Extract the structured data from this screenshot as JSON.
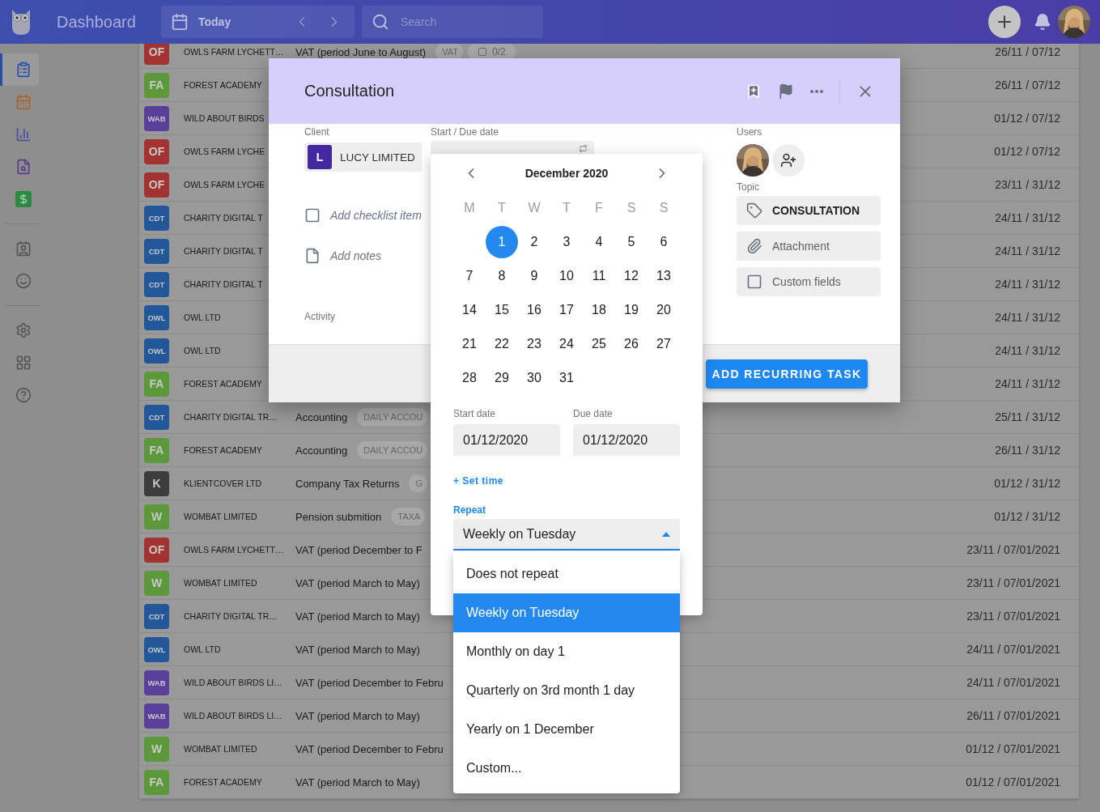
{
  "topbar": {
    "title": "Dashboard",
    "date_label": "Today",
    "search_placeholder": "Search"
  },
  "sidebar": {
    "groups": [
      {
        "items": [
          {
            "selected": true
          },
          {
            "selected": false
          },
          {
            "selected": false
          },
          {
            "selected": false
          },
          {
            "selected": false
          }
        ]
      },
      {
        "items": [
          {
            "selected": false
          },
          {
            "selected": false
          }
        ]
      },
      {
        "items": [
          {
            "selected": false
          },
          {
            "selected": false
          },
          {
            "selected": false
          }
        ]
      }
    ]
  },
  "rows": [
    {
      "initials": "OF",
      "color": "#a33331",
      "client": "OWLS FARM LYCHETT…",
      "task": "VAT (period June to August)",
      "tags": [
        "VAT"
      ],
      "checklist": "0/2",
      "dates": "26/11 / 07/12"
    },
    {
      "initials": "FA",
      "color": "#5b993b",
      "client": "FOREST ACADEMY",
      "dates": "26/11 / 07/12"
    },
    {
      "initials": "WAB",
      "color": "#5a3f9a",
      "client": "WILD ABOUT BIRDS",
      "dates": "01/12 / 07/12"
    },
    {
      "initials": "OF",
      "color": "#a33331",
      "client": "OWLS FARM LYCHE",
      "dates": "01/12 / 07/12"
    },
    {
      "initials": "OF",
      "color": "#a33331",
      "client": "OWLS FARM LYCHE",
      "dates": "23/11 / 31/12"
    },
    {
      "initials": "CDT",
      "color": "#22589a",
      "client": "CHARITY DIGITAL T",
      "dates": "24/11 / 31/12"
    },
    {
      "initials": "CDT",
      "color": "#22589a",
      "client": "CHARITY DIGITAL T",
      "dates": "24/11 / 31/12"
    },
    {
      "initials": "CDT",
      "color": "#22589a",
      "client": "CHARITY DIGITAL T",
      "dates": "24/11 / 31/12"
    },
    {
      "initials": "OWL",
      "color": "#22589a",
      "client": "OWL LTD",
      "dates": "24/11 / 31/12"
    },
    {
      "initials": "OWL",
      "color": "#22589a",
      "client": "OWL LTD",
      "dates": "24/11 / 31/12"
    },
    {
      "initials": "FA",
      "color": "#5b993b",
      "client": "FOREST ACADEMY",
      "dates": "24/11 / 31/12"
    },
    {
      "initials": "CDT",
      "color": "#22589a",
      "client": "CHARITY DIGITAL TR…",
      "task": "Accounting",
      "tags": [
        "DAILY ACCOU"
      ],
      "dates": "25/11 / 31/12"
    },
    {
      "initials": "FA",
      "color": "#5b993b",
      "client": "FOREST ACADEMY",
      "task": "Accounting",
      "tags": [
        "DAILY ACCOU"
      ],
      "dates": "26/11 / 31/12"
    },
    {
      "initials": "K",
      "color": "#3c3c3c",
      "client": "KLIENTCOVER LTD",
      "task": "Company Tax Returns",
      "tags": [
        "G"
      ],
      "dates": "01/12 / 31/12"
    },
    {
      "initials": "W",
      "color": "#5b993b",
      "client": "WOMBAT LIMITED",
      "task": "Pension submition",
      "tags": [
        "TAXA"
      ],
      "dates": "01/12 / 31/12"
    },
    {
      "initials": "OF",
      "color": "#a33331",
      "client": "OWLS FARM LYCHETT…",
      "task": "VAT (period December to F",
      "dates": "23/11 / 07/01/2021"
    },
    {
      "initials": "W",
      "color": "#5b993b",
      "client": "WOMBAT LIMITED",
      "task": "VAT (period March to May)",
      "dates": "23/11 / 07/01/2021"
    },
    {
      "initials": "CDT",
      "color": "#22589a",
      "client": "CHARITY DIGITAL TR…",
      "task": "VAT (period March to May)",
      "dates": "23/11 / 07/01/2021"
    },
    {
      "initials": "OWL",
      "color": "#22589a",
      "client": "OWL LTD",
      "task": "VAT (period March to May)",
      "dates": "24/11 / 07/01/2021"
    },
    {
      "initials": "WAB",
      "color": "#5a3f9a",
      "client": "WILD ABOUT BIRDS LI…",
      "task": "VAT (period December to Febru",
      "dates": "24/11 / 07/01/2021"
    },
    {
      "initials": "WAB",
      "color": "#5a3f9a",
      "client": "WILD ABOUT BIRDS LI…",
      "task": "VAT (period March to May)",
      "dates": "26/11 / 07/01/2021"
    },
    {
      "initials": "W",
      "color": "#5b993b",
      "client": "WOMBAT LIMITED",
      "task": "VAT (period December to Febru",
      "dates": "01/12 / 07/01/2021"
    },
    {
      "initials": "FA",
      "color": "#5b993b",
      "client": "FOREST ACADEMY",
      "task": "VAT (period March to May)",
      "dates": "01/12 / 07/01/2021"
    }
  ],
  "modal": {
    "title": "Consultation",
    "client_label": "Client",
    "client_initial": "L",
    "client_name": "LUCY LIMITED",
    "date_label": "Start / Due date",
    "checklist_placeholder": "Add checklist item",
    "notes_placeholder": "Add notes",
    "activity_label": "Activity",
    "users_label": "Users",
    "topic_label": "Topic",
    "topic": "CONSULTATION",
    "attachment": "Attachment",
    "custom_fields": "Custom fields",
    "submit": "ADD RECURRING TASK"
  },
  "calendar": {
    "month": "December 2020",
    "weekdays": [
      "M",
      "T",
      "W",
      "T",
      "F",
      "S",
      "S"
    ],
    "weeks": [
      [
        {
          "label": "1",
          "selected": true
        },
        {
          "label": "2",
          "selected": false
        },
        {
          "label": "3",
          "selected": false
        },
        {
          "label": "4",
          "selected": false
        },
        {
          "label": "5",
          "selected": false
        },
        {
          "label": "6",
          "selected": false
        }
      ],
      [
        {
          "label": "7",
          "selected": false
        },
        {
          "label": "8",
          "selected": false
        },
        {
          "label": "9",
          "selected": false
        },
        {
          "label": "10",
          "selected": false
        },
        {
          "label": "11",
          "selected": false
        },
        {
          "label": "12",
          "selected": false
        },
        {
          "label": "13",
          "selected": false
        }
      ],
      [
        {
          "label": "14",
          "selected": false
        },
        {
          "label": "15",
          "selected": false
        },
        {
          "label": "16",
          "selected": false
        },
        {
          "label": "17",
          "selected": false
        },
        {
          "label": "18",
          "selected": false
        },
        {
          "label": "19",
          "selected": false
        },
        {
          "label": "20",
          "selected": false
        }
      ],
      [
        {
          "label": "21",
          "selected": false
        },
        {
          "label": "22",
          "selected": false
        },
        {
          "label": "23",
          "selected": false
        },
        {
          "label": "24",
          "selected": false
        },
        {
          "label": "25",
          "selected": false
        },
        {
          "label": "26",
          "selected": false
        },
        {
          "label": "27",
          "selected": false
        }
      ],
      [
        {
          "label": "28",
          "selected": false
        },
        {
          "label": "29",
          "selected": false
        },
        {
          "label": "30",
          "selected": false
        },
        {
          "label": "31",
          "selected": false
        }
      ]
    ],
    "start_label": "Start date",
    "start_value": "01/12/2020",
    "due_label": "Due date",
    "due_value": "01/12/2020",
    "set_time": "+ Set time",
    "repeat_label": "Repeat",
    "repeat_value": "Weekly on Tuesday",
    "repeat_expanded": true,
    "repeat_options": [
      {
        "label": "Does not repeat",
        "selected": false
      },
      {
        "label": "Weekly on Tuesday",
        "selected": true
      },
      {
        "label": "Monthly on day 1",
        "selected": false
      },
      {
        "label": "Quarterly on 3rd month 1 day",
        "selected": false
      },
      {
        "label": "Yearly on 1 December",
        "selected": false
      },
      {
        "label": "Custom...",
        "selected": false
      }
    ]
  }
}
